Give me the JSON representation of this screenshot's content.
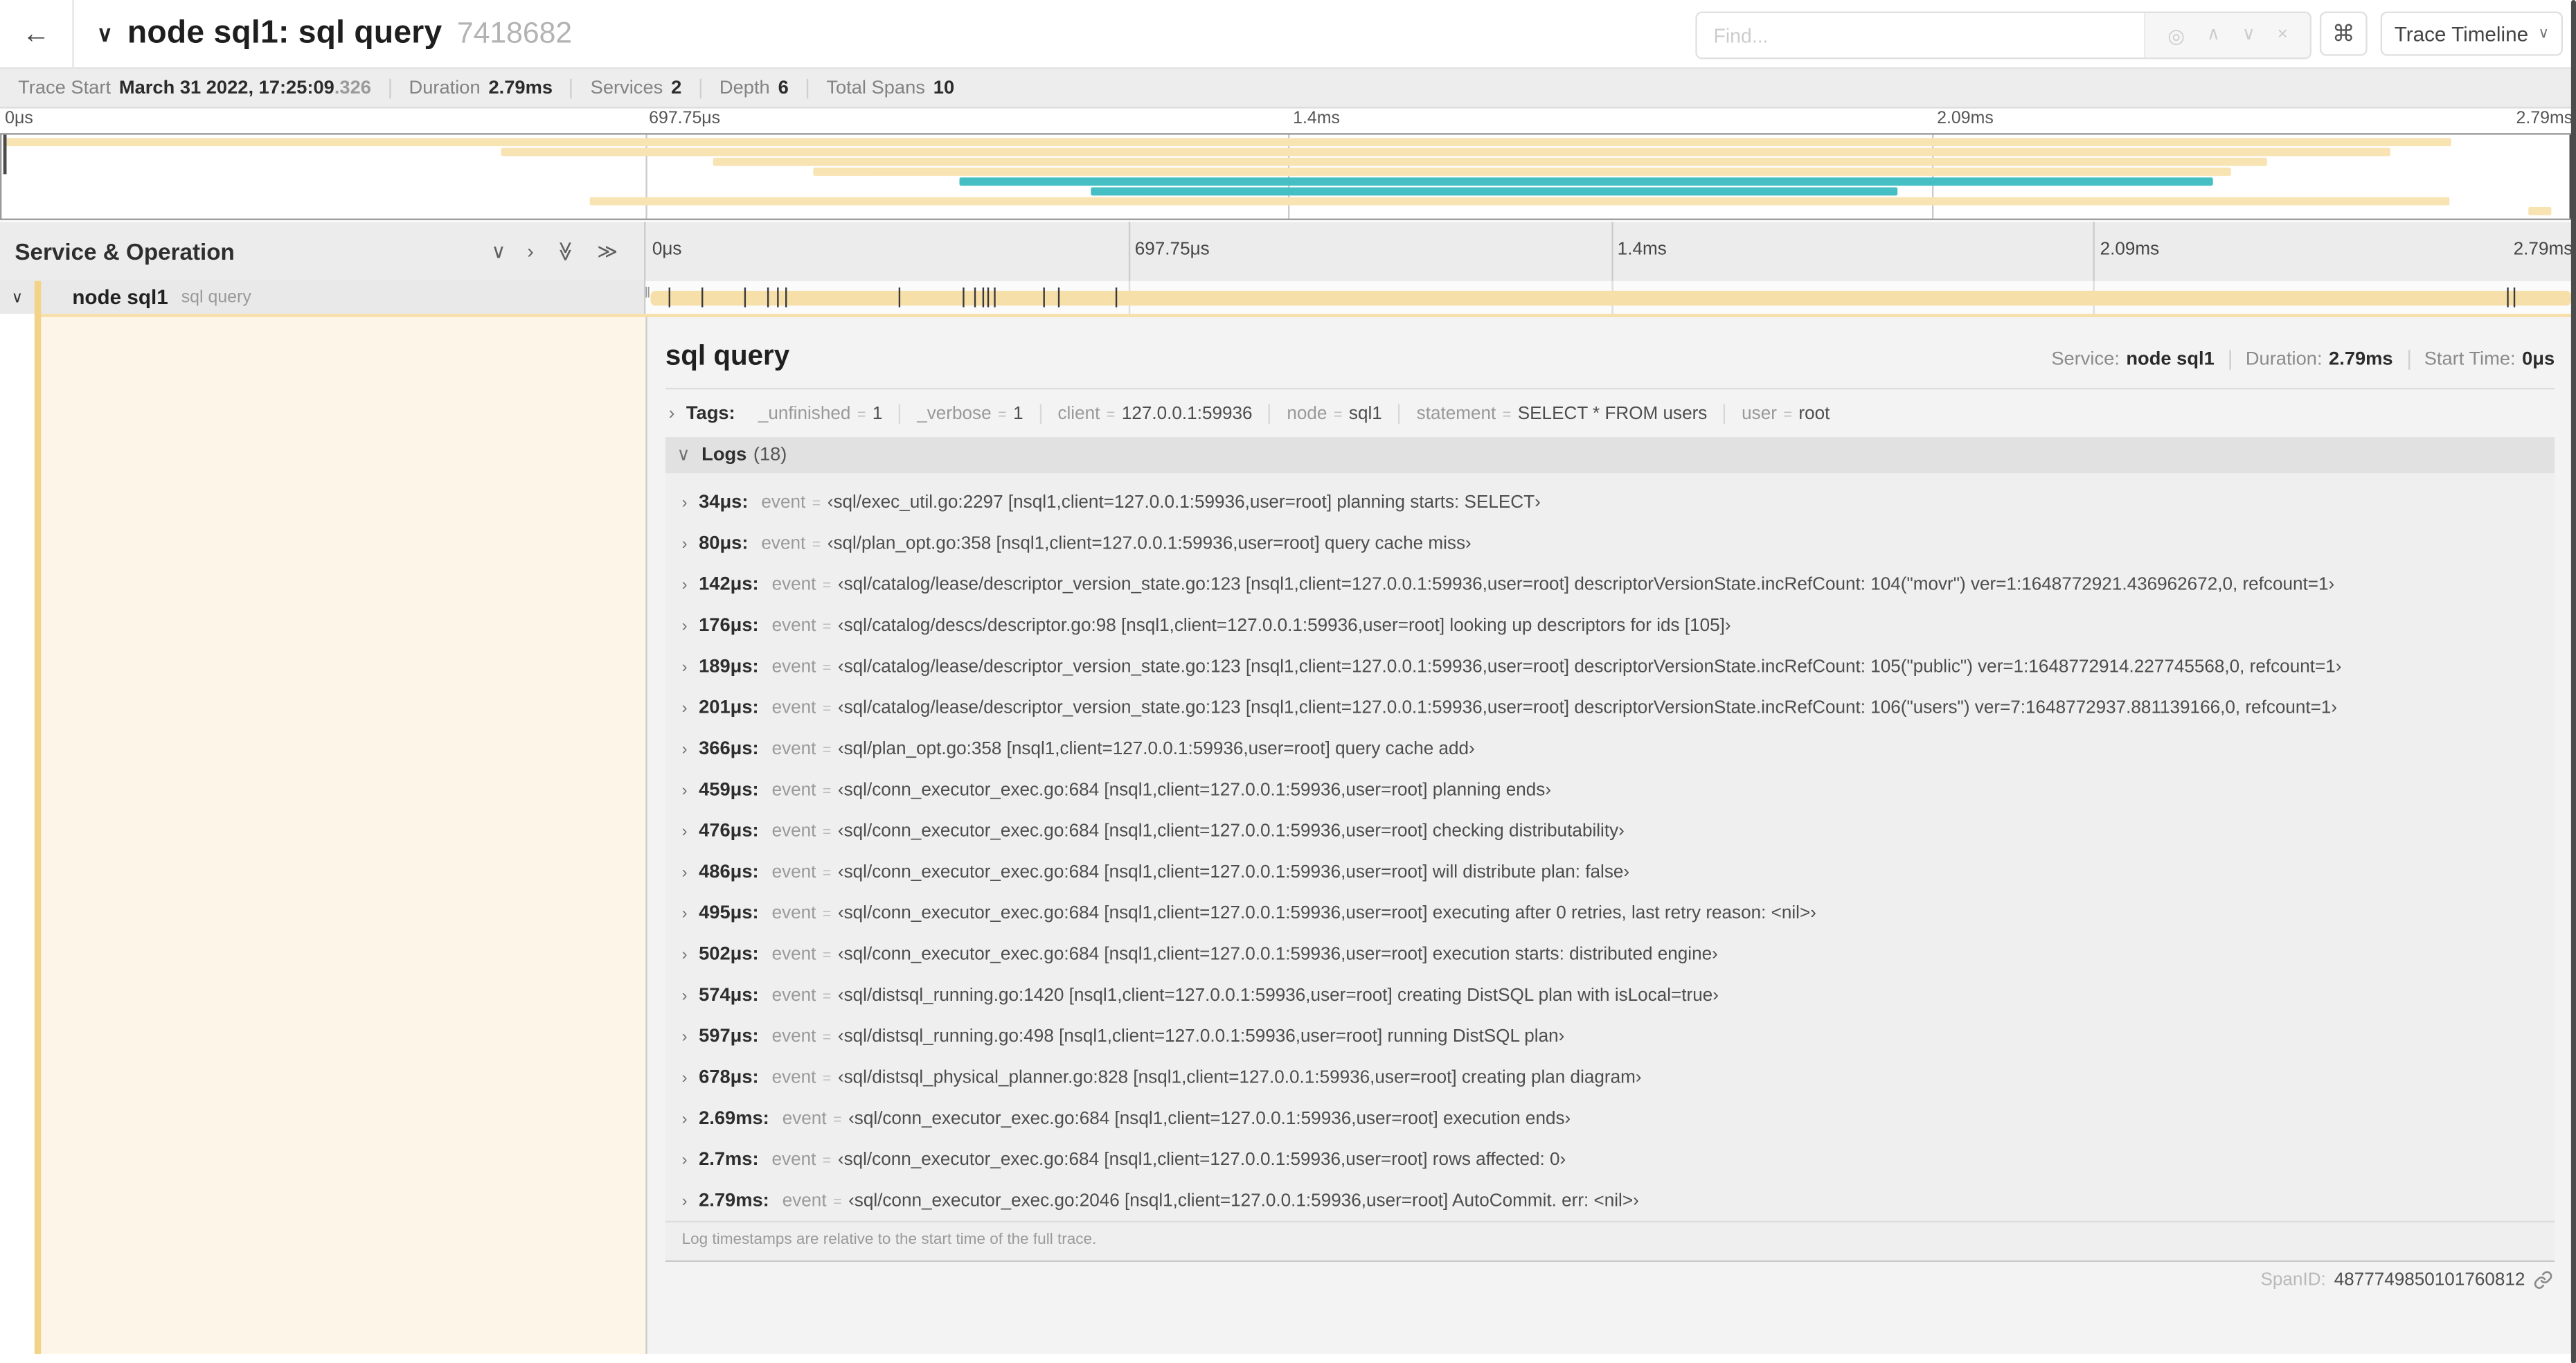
{
  "icons": {
    "back": "←",
    "chevron_down": "∨",
    "chevron_right": "›",
    "double_chevron_right": "≫",
    "locate": "◎",
    "up": "∧",
    "down": "∨",
    "close": "×",
    "command": "⌘",
    "grip": "‖"
  },
  "header": {
    "title": "node sql1: sql query",
    "trace_id_short": "7418682",
    "find_placeholder": "Find...",
    "view_selector": "Trace Timeline"
  },
  "summary": {
    "items": [
      {
        "label": "Trace Start",
        "value": "March 31 2022, 17:25:09",
        "suffix": ".326"
      },
      {
        "label": "Duration",
        "value": "2.79ms",
        "suffix": ""
      },
      {
        "label": "Services",
        "value": "2",
        "suffix": ""
      },
      {
        "label": "Depth",
        "value": "6",
        "suffix": ""
      },
      {
        "label": "Total Spans",
        "value": "10",
        "suffix": ""
      }
    ]
  },
  "minimap": {
    "ticks": [
      {
        "label": "0μs",
        "pct": 0
      },
      {
        "label": "697.75μs",
        "pct": 25
      },
      {
        "label": "1.4ms",
        "pct": 50
      },
      {
        "label": "2.09ms",
        "pct": 75
      },
      {
        "label": "2.79ms",
        "pct": 100
      }
    ],
    "colors": {
      "tan": "#f8e3b3",
      "teal": "#45bfc4"
    },
    "spans": [
      {
        "start": 0,
        "end": 95.3,
        "color": "tan"
      },
      {
        "start": 19.4,
        "end": 92.9,
        "color": "tan"
      },
      {
        "start": 27.6,
        "end": 88.1,
        "color": "tan"
      },
      {
        "start": 31.5,
        "end": 86.7,
        "color": "tan"
      },
      {
        "start": 37.2,
        "end": 86.0,
        "color": "teal"
      },
      {
        "start": 42.3,
        "end": 73.7,
        "color": "teal"
      },
      {
        "start": 22.8,
        "end": 95.2,
        "color": "tan"
      },
      {
        "start": 98.3,
        "end": 99.2,
        "color": "tan"
      }
    ]
  },
  "timeline": {
    "left_header": "Service & Operation",
    "ruler_ticks": [
      {
        "label": "0μs",
        "pct": 0
      },
      {
        "label": "697.75μs",
        "pct": 25
      },
      {
        "label": "1.4ms",
        "pct": 50
      },
      {
        "label": "2.09ms",
        "pct": 75
      },
      {
        "label": "2.79ms",
        "pct": 100
      }
    ],
    "row": {
      "service": "node sql1",
      "operation": "sql query"
    },
    "log_markers_pct": [
      1.22,
      2.87,
      5.09,
      6.31,
      6.77,
      7.2,
      13.12,
      16.45,
      17.06,
      17.42,
      17.74,
      18.0,
      20.57,
      21.4,
      24.3,
      96.42,
      96.77,
      99.85
    ]
  },
  "detail": {
    "title": "sql query",
    "service_label": "Service:",
    "service": "node sql1",
    "duration_label": "Duration:",
    "duration": "2.79ms",
    "start_time_label": "Start Time:",
    "start_time": "0μs",
    "tags_label": "Tags:",
    "eq": "=",
    "tags": [
      {
        "key": "_unfinished",
        "value": "1"
      },
      {
        "key": "_verbose",
        "value": "1"
      },
      {
        "key": "client",
        "value": "127.0.0.1:59936"
      },
      {
        "key": "node",
        "value": "sql1"
      },
      {
        "key": "statement",
        "value": "SELECT * FROM users"
      },
      {
        "key": "user",
        "value": "root"
      }
    ],
    "logs_label": "Logs",
    "logs_count": "(18)",
    "log_field_label": "event",
    "logs": [
      {
        "time": "34μs:",
        "value": "‹sql/exec_util.go:2297 [nsql1,client=127.0.0.1:59936,user=root] planning starts: SELECT›"
      },
      {
        "time": "80μs:",
        "value": "‹sql/plan_opt.go:358 [nsql1,client=127.0.0.1:59936,user=root] query cache miss›"
      },
      {
        "time": "142μs:",
        "value": "‹sql/catalog/lease/descriptor_version_state.go:123 [nsql1,client=127.0.0.1:59936,user=root] descriptorVersionState.incRefCount: 104(\"movr\") ver=1:1648772921.436962672,0, refcount=1›"
      },
      {
        "time": "176μs:",
        "value": "‹sql/catalog/descs/descriptor.go:98 [nsql1,client=127.0.0.1:59936,user=root] looking up descriptors for ids [105]›"
      },
      {
        "time": "189μs:",
        "value": "‹sql/catalog/lease/descriptor_version_state.go:123 [nsql1,client=127.0.0.1:59936,user=root] descriptorVersionState.incRefCount: 105(\"public\") ver=1:1648772914.227745568,0, refcount=1›"
      },
      {
        "time": "201μs:",
        "value": "‹sql/catalog/lease/descriptor_version_state.go:123 [nsql1,client=127.0.0.1:59936,user=root] descriptorVersionState.incRefCount: 106(\"users\") ver=7:1648772937.881139166,0, refcount=1›"
      },
      {
        "time": "366μs:",
        "value": "‹sql/plan_opt.go:358 [nsql1,client=127.0.0.1:59936,user=root] query cache add›"
      },
      {
        "time": "459μs:",
        "value": "‹sql/conn_executor_exec.go:684 [nsql1,client=127.0.0.1:59936,user=root] planning ends›"
      },
      {
        "time": "476μs:",
        "value": "‹sql/conn_executor_exec.go:684 [nsql1,client=127.0.0.1:59936,user=root] checking distributability›"
      },
      {
        "time": "486μs:",
        "value": "‹sql/conn_executor_exec.go:684 [nsql1,client=127.0.0.1:59936,user=root] will distribute plan: false›"
      },
      {
        "time": "495μs:",
        "value": "‹sql/conn_executor_exec.go:684 [nsql1,client=127.0.0.1:59936,user=root] executing after 0 retries, last retry reason: <nil>›"
      },
      {
        "time": "502μs:",
        "value": "‹sql/conn_executor_exec.go:684 [nsql1,client=127.0.0.1:59936,user=root] execution starts: distributed engine›"
      },
      {
        "time": "574μs:",
        "value": "‹sql/distsql_running.go:1420 [nsql1,client=127.0.0.1:59936,user=root] creating DistSQL plan with isLocal=true›"
      },
      {
        "time": "597μs:",
        "value": "‹sql/distsql_running.go:498 [nsql1,client=127.0.0.1:59936,user=root] running DistSQL plan›"
      },
      {
        "time": "678μs:",
        "value": "‹sql/distsql_physical_planner.go:828 [nsql1,client=127.0.0.1:59936,user=root] creating plan diagram›"
      },
      {
        "time": "2.69ms:",
        "value": "‹sql/conn_executor_exec.go:684 [nsql1,client=127.0.0.1:59936,user=root] execution ends›"
      },
      {
        "time": "2.7ms:",
        "value": "‹sql/conn_executor_exec.go:684 [nsql1,client=127.0.0.1:59936,user=root] rows affected: 0›"
      },
      {
        "time": "2.79ms:",
        "value": "‹sql/conn_executor_exec.go:2046 [nsql1,client=127.0.0.1:59936,user=root] AutoCommit. err: <nil>›"
      }
    ],
    "logs_footnote": "Log timestamps are relative to the start time of the full trace.",
    "spanid_label": "SpanID:",
    "spanid_value": "4877749850101760812"
  }
}
